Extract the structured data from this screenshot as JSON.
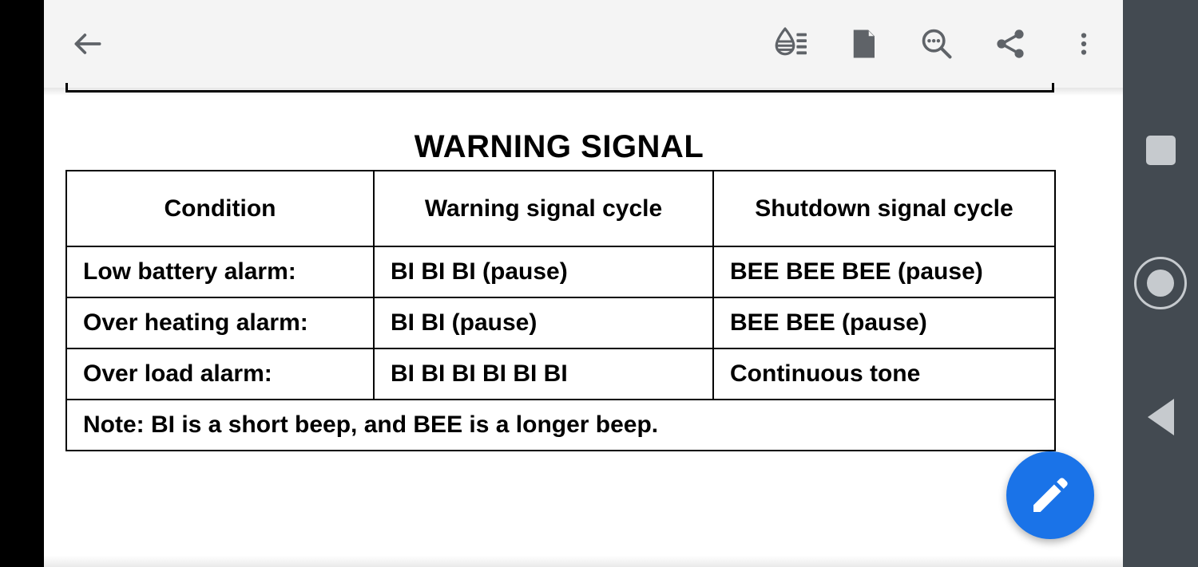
{
  "app": {
    "toolbar": {
      "back_label": "Back",
      "actions": [
        {
          "name": "theme-icon",
          "label": "Display / theme"
        },
        {
          "name": "page-icon",
          "label": "Page mode"
        },
        {
          "name": "search-icon",
          "label": "Search"
        },
        {
          "name": "share-icon",
          "label": "Share"
        },
        {
          "name": "overflow-icon",
          "label": "More options"
        }
      ]
    },
    "fab": {
      "label": "Edit",
      "icon": "pencil-icon",
      "color": "#1a73e8"
    }
  },
  "document": {
    "title": "WARNING SIGNAL",
    "table": {
      "headers": [
        "Condition",
        "Warning signal cycle",
        "Shutdown signal cycle"
      ],
      "rows": [
        [
          "Low battery alarm:",
          "BI BI BI (pause)",
          "BEE BEE BEE (pause)"
        ],
        [
          "Over heating alarm:",
          "BI BI (pause)",
          "BEE BEE (pause)"
        ],
        [
          "Over load alarm:",
          "BI BI BI BI BI BI",
          "Continuous tone"
        ]
      ],
      "note": "Note: BI is a short beep, and BEE is a longer beep."
    }
  },
  "navbar": {
    "recents_label": "Overview",
    "home_label": "Home",
    "back_label": "Back",
    "background": "#434a51"
  }
}
